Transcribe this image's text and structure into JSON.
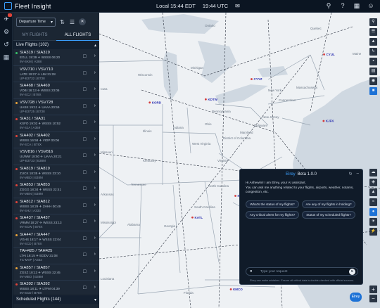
{
  "app": {
    "title": "Fleet Insight"
  },
  "clock": {
    "local": "Local 15:44 EDT",
    "utc": "19:44 UTC"
  },
  "panel": {
    "sort_select": "Departure Time",
    "tabs": [
      "MY FLIGHTS",
      "ALL FLIGHTS"
    ],
    "live_header": "Live Flights (102)",
    "scheduled_header": "Scheduled Flights (144)",
    "flights": [
      {
        "id": "SIA319 / SIA319",
        "route": "EGLL 19:39 ✈ WSSS 06:20",
        "reg": "9V-SKM | A388",
        "dot": "#39c46b"
      },
      {
        "id": "VSV710 / VSV710",
        "route": "LATE 19:27 ✈ LIM 21:28",
        "reg": "UP-B3732 | B738",
        "dot": ""
      },
      {
        "id": "SIA468 / SIA469",
        "route": "VOBI 16:13 ✈ WSSS 23:06",
        "reg": "9V-SCJ | B78X",
        "dot": ""
      },
      {
        "id": "VSV728 / VSV728",
        "route": "UASK 19:11 ✈ UAAA 20:59",
        "reg": "UP-B3725 | B738",
        "dot": "#e8a33a"
      },
      {
        "id": "SIA31 / SIA31",
        "route": "KSFO 19:02 ✈ WSSS 10:52",
        "reg": "9V-SJA | A359",
        "dot": "#e0443a"
      },
      {
        "id": "SIA402 / SIA402",
        "route": "WSSS 16:58 ✈ VIDP 00:06",
        "reg": "9V-SCA | B78X",
        "dot": "#e0443a"
      },
      {
        "id": "VSV816 / VSV816",
        "route": "UUWW 18:50 ✈ UAAA 20:21",
        "reg": "UP-B3733 | B38M",
        "dot": ""
      },
      {
        "id": "SIA819 / SIA819",
        "route": "ZUCK 18:35 ✈ WSSS 23:10",
        "reg": "9V-MBD | B38M",
        "dot": "#e0443a"
      },
      {
        "id": "SIA853 / SIA853",
        "route": "ZGGG 18:34 ✈ WSSS 22:41",
        "reg": "9V-MBN | B38M",
        "dot": "#e0443a"
      },
      {
        "id": "SIA812 / SIA812",
        "route": "WSSS 18:29 ✈ ZHHH 00:49",
        "reg": "9V-SHJ | A333",
        "dot": "#e0443a"
      },
      {
        "id": "SIA437 / SIA437",
        "route": "VRMM 18:27 ✈ WSSS 23:13",
        "reg": "9V-SCW | B78X",
        "dot": "#e0443a"
      },
      {
        "id": "SIA447 / SIA447",
        "route": "VGHS 18:17 ✈ WSSS 22:04",
        "reg": "9V-SCD | B78X",
        "dot": "#e8a33a"
      },
      {
        "id": "TAH425 / TAH425",
        "route": "LTAI 18:15 ✈ EDDV 21:08",
        "reg": "TC-MVP | A332",
        "dot": ""
      },
      {
        "id": "SIA857 / SIA857",
        "route": "ZGSZ 18:13 ✈ WSSS 22:45",
        "reg": "9V-MBO | B38M",
        "dot": "#e8a33a"
      },
      {
        "id": "SIA392 / SIA392",
        "route": "WSSS 18:11 ✈ LTFM 04:39",
        "reg": "9V-SCD | B78X",
        "dot": "#e0443a"
      }
    ]
  },
  "map": {
    "airports": [
      {
        "code": "CYUL",
        "lon": -73.74,
        "lat": 45.47
      },
      {
        "code": "CYYZ",
        "lon": -79.63,
        "lat": 43.68
      },
      {
        "code": "KORD",
        "lon": -87.9,
        "lat": 41.98
      },
      {
        "code": "KDTW",
        "lon": -83.35,
        "lat": 42.21
      },
      {
        "code": "KJFK",
        "lon": -73.78,
        "lat": 40.64
      },
      {
        "code": "KCLT",
        "lon": -80.94,
        "lat": 35.21
      },
      {
        "code": "KATL",
        "lon": -84.43,
        "lat": 33.64
      },
      {
        "code": "KMCO",
        "lon": -81.31,
        "lat": 28.43
      }
    ],
    "place_labels": [
      "Quebec",
      "Ontario",
      "Michigan",
      "Wisconsin",
      "Illinois",
      "Indiana",
      "Ohio",
      "Pennsylvania",
      "New York",
      "Maine",
      "Massachusetts",
      "Connecticut",
      "New Jersey",
      "Maryland",
      "Delaware",
      "District of Columbia",
      "West Virginia",
      "Virginia",
      "Kentucky",
      "Tennessee",
      "North Carolina",
      "South Carolina",
      "Georgia",
      "Alabama",
      "Mississippi",
      "Florida",
      "Iowa",
      "Missouri",
      "Arkansas",
      "Louisiana"
    ],
    "zoom_in": "+",
    "zoom_out": "−"
  },
  "chat": {
    "name": "Elrey",
    "version": "Beta 1.0.0",
    "greeting": "Hi Ashewini! I am Elrey, your AI assistant.",
    "intro": "You can ask me anything related to your flights, airports, weather, notams, congestion, etc.",
    "suggestions": [
      "What's the status of my flights?",
      "Are any of my flights in holding?",
      "Any critical alerts for my flights?",
      "Status of my scheduled flights?"
    ],
    "input_placeholder": "Type your request",
    "footer": "Elrey can make mistakes. Ensure all critical data is double-checked with official sources.",
    "fab_label": "Elrey"
  }
}
